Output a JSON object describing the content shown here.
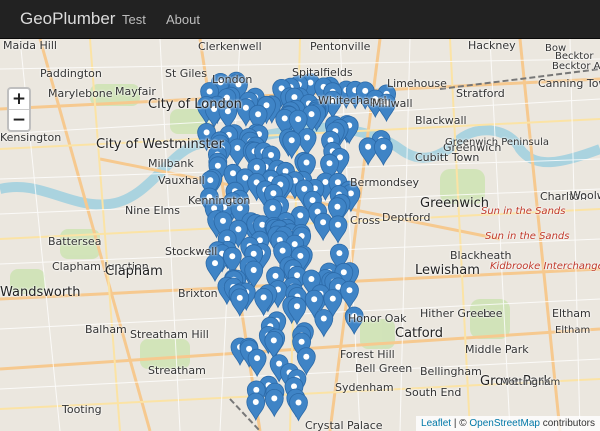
{
  "navbar": {
    "brand": "GeoPlumber",
    "links": [
      "Test",
      "About"
    ]
  },
  "map": {
    "zoom_in": "+",
    "zoom_out": "−",
    "attribution": {
      "leaflet": "Leaflet",
      "separator": " | © ",
      "osm": "OpenStreetMap",
      "suffix": " contributors"
    },
    "marker_color": "#3f84c6",
    "labels": [
      "Maida Hill",
      "Clerkenwell",
      "Pentonville",
      "Hackney",
      "Bow",
      "Becktor",
      "Paddington",
      "St Giles",
      "Spitalfields",
      "Becktor Alp",
      "Marylebone",
      "Mayfair",
      "City of London",
      "Whitechapel",
      "Millwall",
      "Stratford",
      "London",
      "Limehouse",
      "Canning Town",
      "City of Westminster",
      "Blackwall",
      "Kensington",
      "Greenwich",
      "Millbank",
      "Greenwich Peninsula",
      "Cubitt Town",
      "Charlton",
      "Vauxhall",
      "Nine Elms",
      "Kennington",
      "Bermondsey",
      "Deptford",
      "Greenwich",
      "Battersea",
      "Stockwell",
      "Cross",
      "Blackheath",
      "Clapham Junction",
      "Clapham",
      "Brixton",
      "Lewisham",
      "Wandsworth",
      "Streatham Hill",
      "Balham",
      "Honor Oak",
      "Catford",
      "Hither Green",
      "Lee",
      "Eltham",
      "Tooting",
      "Forest Hill",
      "Sydenham",
      "Grove Park",
      "South End",
      "Crystal Palace",
      "Woolw",
      "Bell Green",
      "Middle Park",
      "Kidbrooke Interchange",
      "Sun in the Sands",
      "Sun in the Sands",
      "Streatham",
      "Bellingham",
      "Mottingham",
      "Eltham"
    ]
  }
}
